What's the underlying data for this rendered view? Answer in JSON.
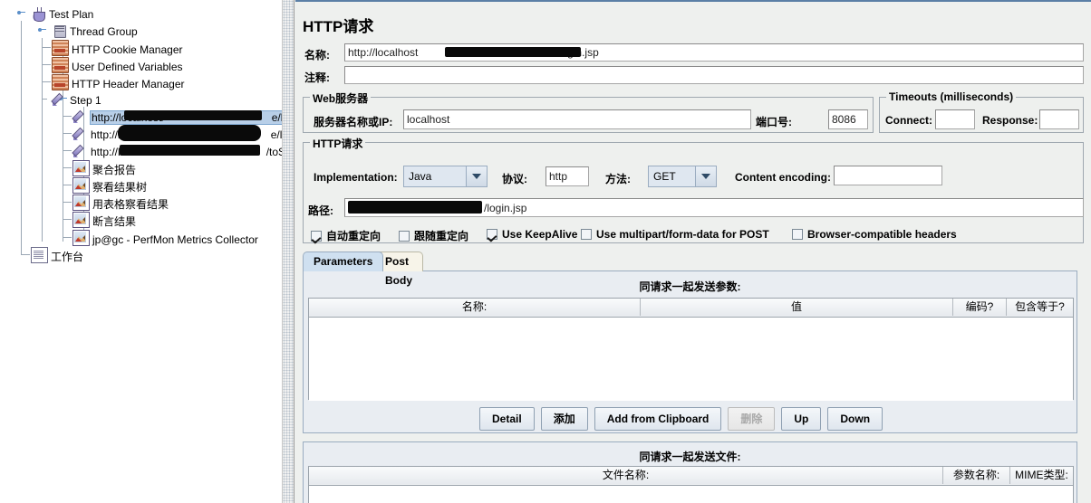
{
  "tree": {
    "nodes": [
      {
        "label": "Test Plan",
        "icon": "test-plan-icon",
        "depth": 0,
        "selected": false
      },
      {
        "label": "Thread Group",
        "icon": "thread-group-icon",
        "depth": 1,
        "selected": false
      },
      {
        "label": "HTTP Cookie Manager",
        "icon": "config-element-icon",
        "depth": 2,
        "selected": false
      },
      {
        "label": "User Defined Variables",
        "icon": "config-element-icon",
        "depth": 2,
        "selected": false
      },
      {
        "label": "HTTP Header Manager",
        "icon": "config-element-icon",
        "depth": 2,
        "selected": false
      },
      {
        "label": "Step 1",
        "icon": "transaction-controller-icon",
        "depth": 2,
        "selected": false
      },
      {
        "label": "http://localhost/",
        "icon": "http-sampler-icon",
        "depth": 3,
        "selected": true,
        "suffix": "e/login.j"
      },
      {
        "label": "http://localhost/",
        "icon": "http-sampler-icon",
        "depth": 3,
        "selected": false,
        "suffix": "e/login.c"
      },
      {
        "label": "http://localhost/",
        "icon": "http-sampler-icon",
        "depth": 3,
        "selected": false,
        "suffix": "/toSho"
      },
      {
        "label": "聚合报告",
        "icon": "listener-icon",
        "depth": 3,
        "selected": false
      },
      {
        "label": "察看结果树",
        "icon": "listener-icon",
        "depth": 3,
        "selected": false
      },
      {
        "label": "用表格察看结果",
        "icon": "listener-icon",
        "depth": 3,
        "selected": false
      },
      {
        "label": "断言结果",
        "icon": "listener-icon",
        "depth": 3,
        "selected": false
      },
      {
        "label": "jp@gc - PerfMon Metrics Collector",
        "icon": "listener-icon",
        "depth": 3,
        "selected": false
      },
      {
        "label": "工作台",
        "icon": "workbench-icon",
        "depth": 1,
        "selected": false
      }
    ]
  },
  "panel": {
    "title": "HTTP请求",
    "name_label": "名称:",
    "name_value": "http://localhost/login.jsp",
    "name_value_prefix": "http://localhost",
    "name_value_suffix": "/login.jsp",
    "comment_label": "注释:",
    "comment_value": ""
  },
  "webserver": {
    "title": "Web服务器",
    "server_label": "服务器名称或IP:",
    "server_value": "localhost",
    "port_label": "端口号:",
    "port_value": "8086"
  },
  "timeouts": {
    "title": "Timeouts (milliseconds)",
    "connect_label": "Connect:",
    "connect_value": "",
    "response_label": "Response:",
    "response_value": ""
  },
  "httprequest": {
    "title": "HTTP请求",
    "implementation_label": "Implementation:",
    "implementation_value": "Java",
    "protocol_label": "协议:",
    "protocol_value": "http",
    "method_label": "方法:",
    "method_value": "GET",
    "content_encoding_label": "Content encoding:",
    "content_encoding_value": "",
    "path_label": "路径:",
    "path_value": "/login.jsp",
    "path_suffix": "/login.jsp"
  },
  "options": [
    {
      "label": "自动重定向",
      "checked": true
    },
    {
      "label": "跟随重定向",
      "checked": false
    },
    {
      "label": "Use KeepAlive",
      "checked": true
    },
    {
      "label": "Use multipart/form-data for POST",
      "checked": false
    },
    {
      "label": "Browser-compatible headers",
      "checked": false
    }
  ],
  "tabs": [
    {
      "label": "Parameters",
      "selected": true
    },
    {
      "label": "Post Body",
      "selected": false
    }
  ],
  "params_section": {
    "caption": "同请求一起发送参数:",
    "columns": [
      "名称:",
      "值",
      "编码?",
      "包含等于?"
    ],
    "rows": []
  },
  "params_buttons": [
    {
      "label": "Detail",
      "enabled": true
    },
    {
      "label": "添加",
      "enabled": true
    },
    {
      "label": "Add from Clipboard",
      "enabled": true
    },
    {
      "label": "删除",
      "enabled": false
    },
    {
      "label": "Up",
      "enabled": true
    },
    {
      "label": "Down",
      "enabled": true
    }
  ],
  "files_section": {
    "caption": "同请求一起发送文件:",
    "columns": [
      "文件名称:",
      "参数名称:",
      "MIME类型:"
    ],
    "rows": []
  },
  "colors": {
    "selection": "#b8cfe8",
    "tab_selected": "#cfe0f0",
    "tab_unselected": "#f7f4e9",
    "panel_bg": "#eef0ee",
    "accent_border": "#5b7fa6"
  }
}
